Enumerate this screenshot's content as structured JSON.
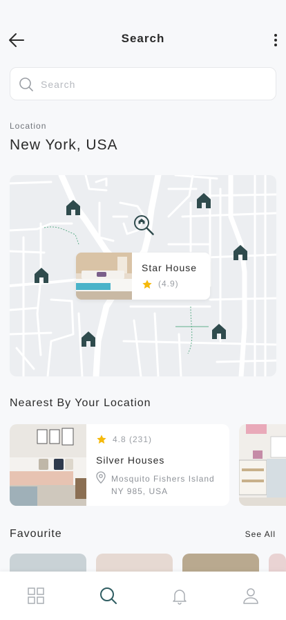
{
  "header": {
    "title": "Search",
    "back_icon": "arrow-left-icon",
    "more_icon": "more-vertical-icon"
  },
  "search": {
    "placeholder": "Search",
    "value": "",
    "icon": "search-icon"
  },
  "location": {
    "label": "Location",
    "value": "New York, USA"
  },
  "map": {
    "popup": {
      "name": "Star House",
      "rating": "(4.9)"
    },
    "colors": {
      "pin": "#2f4b4d",
      "road": "#ffffff",
      "trail": "#5fae8a",
      "background": "#eceef1"
    }
  },
  "nearest": {
    "title": "Nearest By Your Location",
    "items": [
      {
        "rating": "4.8 (231)",
        "name": "Silver Houses",
        "address_line1": "Mosquito Fishers Island",
        "address_line2": "NY 985, USA"
      }
    ]
  },
  "favourite": {
    "title": "Favourite",
    "see_all": "See All"
  },
  "tabbar": {
    "items": [
      {
        "icon": "grid-icon",
        "active": false
      },
      {
        "icon": "search-icon",
        "active": true
      },
      {
        "icon": "bell-icon",
        "active": false
      },
      {
        "icon": "user-icon",
        "active": false
      }
    ],
    "active_color": "#2f5d62",
    "inactive_color": "#a9adb3"
  },
  "colors": {
    "accent": "#2f5d62",
    "star": "#f5b90b"
  }
}
